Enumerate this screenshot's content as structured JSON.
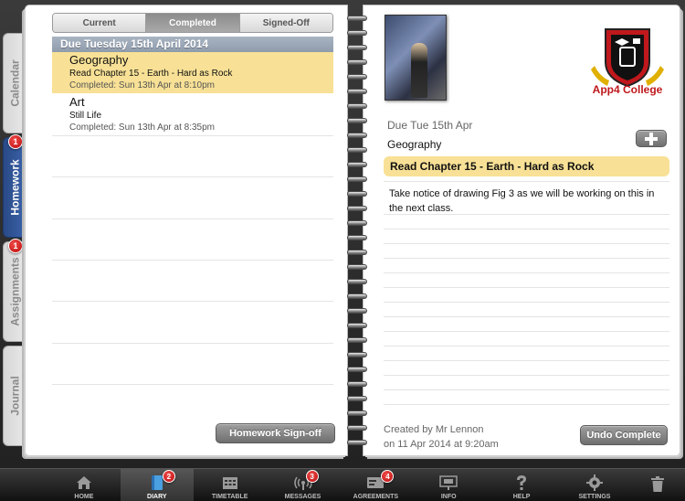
{
  "side_tabs": [
    {
      "label": "Calendar",
      "active": false,
      "badge": ""
    },
    {
      "label": "Homework",
      "active": true,
      "badge": "1"
    },
    {
      "label": "Assignments",
      "active": false,
      "badge": "1"
    },
    {
      "label": "Journal",
      "active": false,
      "badge": ""
    }
  ],
  "segmented": {
    "current": "Current",
    "completed": "Completed",
    "signed_off": "Signed-Off"
  },
  "section_header": "Due Tuesday 15th April 2014",
  "homework_items": [
    {
      "subject": "Geography",
      "title": "Read Chapter 15 - Earth - Hard as Rock",
      "completed": "Completed: Sun 13th Apr at 8:10pm"
    },
    {
      "subject": "Art",
      "title": "Still Life",
      "completed": "Completed: Sun 13th Apr at 8:35pm"
    }
  ],
  "signoff_button": "Homework Sign-off",
  "detail": {
    "logo_text": "App4 College",
    "due": "Due Tue 15th Apr",
    "subject": "Geography",
    "title": "Read Chapter 15 - Earth - Hard as Rock",
    "notes": "Take notice of drawing Fig 3 as we will be working on this in the next class.",
    "created_by": "Created by Mr Lennon",
    "created_on": "on 11 Apr 2014 at 9:20am",
    "undo_button": "Undo Complete"
  },
  "tabbar": [
    {
      "label": "HOME",
      "icon": "home-icon",
      "badge": "",
      "active": false
    },
    {
      "label": "DIARY",
      "icon": "diary-icon",
      "badge": "2",
      "active": true
    },
    {
      "label": "TIMETABLE",
      "icon": "timetable-icon",
      "badge": "",
      "active": false
    },
    {
      "label": "MESSAGES",
      "icon": "messages-icon",
      "badge": "3",
      "active": false
    },
    {
      "label": "AGREEMENTS",
      "icon": "agreements-icon",
      "badge": "4",
      "active": false
    },
    {
      "label": "INFO",
      "icon": "info-icon",
      "badge": "",
      "active": false
    },
    {
      "label": "HELP",
      "icon": "help-icon",
      "badge": "",
      "active": false
    },
    {
      "label": "SETTINGS",
      "icon": "settings-icon",
      "badge": "",
      "active": false
    },
    {
      "label": "",
      "icon": "trash-icon",
      "badge": "",
      "active": false
    }
  ]
}
